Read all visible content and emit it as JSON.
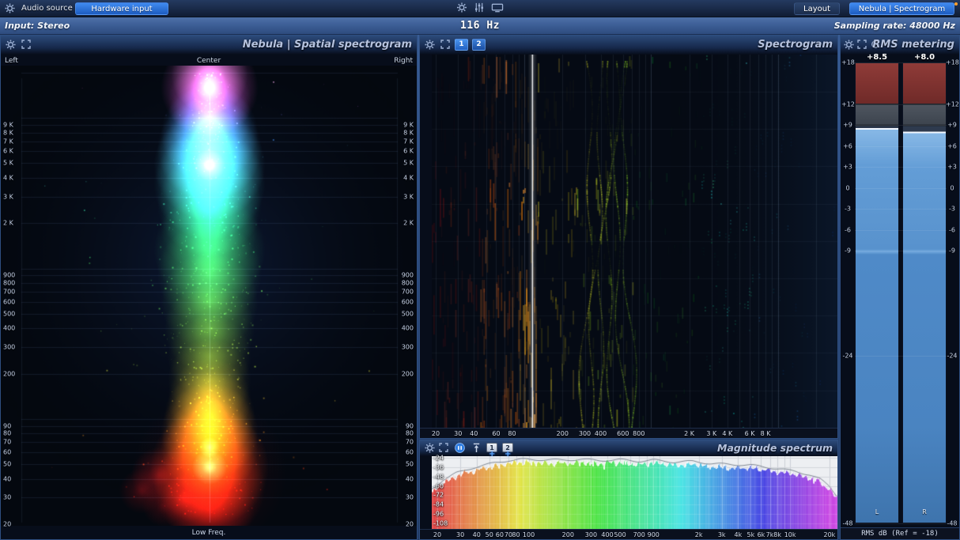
{
  "topbar": {
    "audio_source_label": "Audio source",
    "hardware_input_button": "Hardware input",
    "layout_button": "Layout",
    "view_button": "Nebula | Spectrogram",
    "input_label": "Input: Stereo",
    "freq_readout": "116 Hz",
    "sampling_rate_label": "Sampling rate: 48000 Hz"
  },
  "spatial": {
    "title": "Nebula | Spatial spectrogram",
    "pan_labels": {
      "left": "Left",
      "center": "Center",
      "right": "Right"
    },
    "bottom_label": "Low Freq.",
    "freq_ticks": [
      {
        "f": 9000,
        "label": "9 K"
      },
      {
        "f": 8000,
        "label": "8 K"
      },
      {
        "f": 7000,
        "label": "7 K"
      },
      {
        "f": 6000,
        "label": "6 K"
      },
      {
        "f": 5000,
        "label": "5 K"
      },
      {
        "f": 4000,
        "label": "4 K"
      },
      {
        "f": 3000,
        "label": "3 K"
      },
      {
        "f": 2000,
        "label": "2 K"
      },
      {
        "f": 900,
        "label": "900"
      },
      {
        "f": 800,
        "label": "800"
      },
      {
        "f": 700,
        "label": "700"
      },
      {
        "f": 600,
        "label": "600"
      },
      {
        "f": 500,
        "label": "500"
      },
      {
        "f": 400,
        "label": "400"
      },
      {
        "f": 300,
        "label": "300"
      },
      {
        "f": 200,
        "label": "200"
      },
      {
        "f": 90,
        "label": "90"
      },
      {
        "f": 80,
        "label": "80"
      },
      {
        "f": 70,
        "label": "70"
      },
      {
        "f": 60,
        "label": "60"
      },
      {
        "f": 50,
        "label": "50"
      },
      {
        "f": 40,
        "label": "40"
      },
      {
        "f": 30,
        "label": "30"
      },
      {
        "f": 20,
        "label": "20"
      }
    ]
  },
  "spectrogram": {
    "title": "Spectrogram",
    "view_buttons": [
      "1",
      "2"
    ],
    "cursor_hz": 116,
    "freq_ticks": [
      {
        "f": 20,
        "label": "20"
      },
      {
        "f": 30,
        "label": "30"
      },
      {
        "f": 40,
        "label": "40"
      },
      {
        "f": 60,
        "label": "60"
      },
      {
        "f": 80,
        "label": "80"
      },
      {
        "f": 200,
        "label": "200"
      },
      {
        "f": 300,
        "label": "300"
      },
      {
        "f": 400,
        "label": "400"
      },
      {
        "f": 600,
        "label": "600"
      },
      {
        "f": 800,
        "label": "800"
      },
      {
        "f": 2000,
        "label": "2 K"
      },
      {
        "f": 3000,
        "label": "3 K"
      },
      {
        "f": 4000,
        "label": "4 K"
      },
      {
        "f": 6000,
        "label": "6 K"
      },
      {
        "f": 8000,
        "label": "8 K"
      }
    ]
  },
  "magnitude": {
    "title": "Magnitude spectrum",
    "view_buttons": [
      "1",
      "2"
    ],
    "db_ticks": [
      {
        "db": -24,
        "label": "-24"
      },
      {
        "db": -36,
        "label": "-36"
      },
      {
        "db": -48,
        "label": "-48"
      },
      {
        "db": -60,
        "label": "-60"
      },
      {
        "db": -72,
        "label": "-72"
      },
      {
        "db": -84,
        "label": "-84"
      },
      {
        "db": -96,
        "label": "-96"
      },
      {
        "db": -108,
        "label": "-108"
      }
    ],
    "freq_ticks": [
      {
        "f": 20,
        "label": "20"
      },
      {
        "f": 30,
        "label": "30"
      },
      {
        "f": 40,
        "label": "40"
      },
      {
        "f": 50,
        "label": "50"
      },
      {
        "f": 60,
        "label": "60"
      },
      {
        "f": 70,
        "label": "70"
      },
      {
        "f": 80,
        "label": "80"
      },
      {
        "f": 100,
        "label": "100"
      },
      {
        "f": 200,
        "label": "200"
      },
      {
        "f": 300,
        "label": "300"
      },
      {
        "f": 400,
        "label": "400"
      },
      {
        "f": 500,
        "label": "500"
      },
      {
        "f": 700,
        "label": "700"
      },
      {
        "f": 900,
        "label": "900"
      },
      {
        "f": 2000,
        "label": "2k"
      },
      {
        "f": 3000,
        "label": "3k"
      },
      {
        "f": 4000,
        "label": "4k"
      },
      {
        "f": 5000,
        "label": "5k"
      },
      {
        "f": 6000,
        "label": "6k"
      },
      {
        "f": 7000,
        "label": "7k"
      },
      {
        "f": 8000,
        "label": "8k"
      },
      {
        "f": 10000,
        "label": "10k"
      },
      {
        "f": 20000,
        "label": "20k"
      }
    ]
  },
  "rms": {
    "title": "RMS metering",
    "channels": [
      {
        "label": "L",
        "value_label": "+8.5",
        "value_db": 8.5
      },
      {
        "label": "R",
        "value_label": "+8.0",
        "value_db": 8.0
      }
    ],
    "scale_ticks": [
      {
        "db": 18,
        "label": "+18"
      },
      {
        "db": 12,
        "label": "+12"
      },
      {
        "db": 9,
        "label": "+9"
      },
      {
        "db": 6,
        "label": "+6"
      },
      {
        "db": 3,
        "label": "+3"
      },
      {
        "db": 0,
        "label": "0"
      },
      {
        "db": -3,
        "label": "-3"
      },
      {
        "db": -6,
        "label": "-6"
      },
      {
        "db": -9,
        "label": "-9"
      },
      {
        "db": -24,
        "label": "-24"
      },
      {
        "db": -48,
        "label": "-48"
      }
    ],
    "footer_label": "RMS dB (Ref = -18)"
  },
  "colors": {
    "accent_blue": "#2f7de0",
    "meter_blue": "#5892cd",
    "meter_red_zone": "#8f3b38",
    "notification_orange": "#ffa030"
  }
}
